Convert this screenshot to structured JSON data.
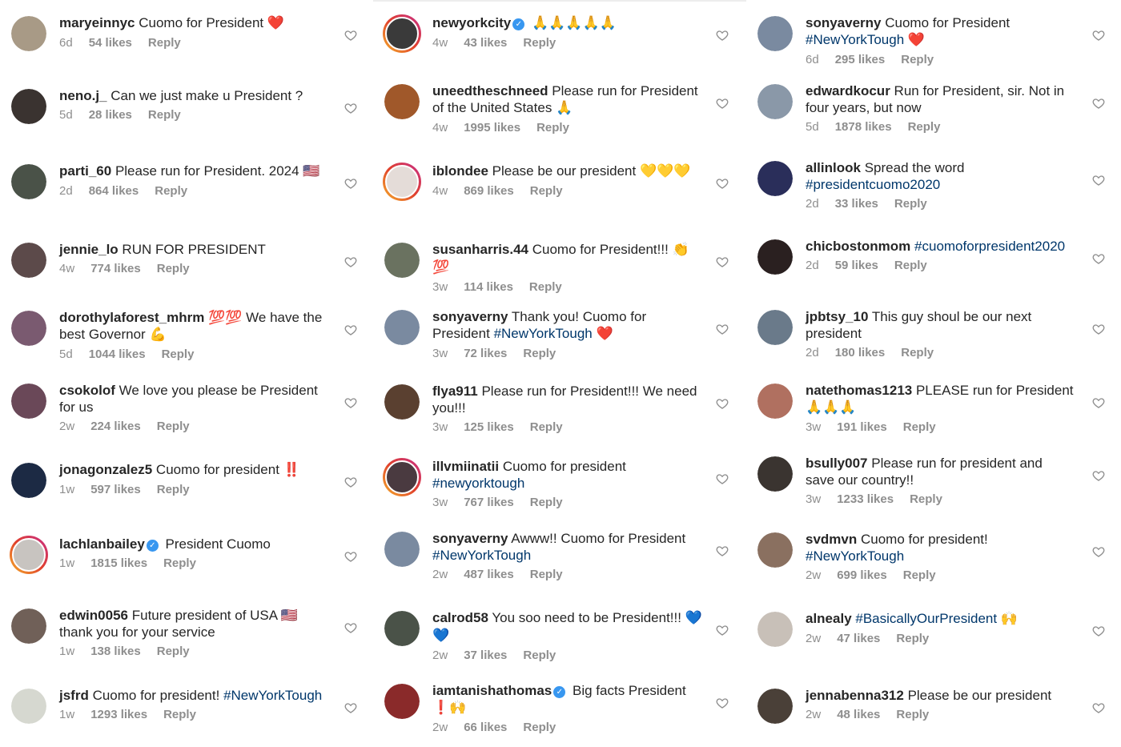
{
  "columns": [
    [
      {
        "user": "maryeinnyc",
        "verified": false,
        "text": "Cuomo for President",
        "tag": "",
        "emoji": "❤️",
        "emoji_color": "#e0202c",
        "time": "6d",
        "likes": "54 likes",
        "reply": "Reply",
        "avatar_color": "#a89a86",
        "ring": false
      },
      {
        "user": "neno.j_",
        "verified": false,
        "text": "Can we just make u President ?",
        "tag": "",
        "emoji": "",
        "time": "5d",
        "likes": "28 likes",
        "reply": "Reply",
        "avatar_color": "#3a3330",
        "ring": false
      },
      {
        "user": "parti_60",
        "verified": false,
        "text": "Please run for President. 2024",
        "tag": "",
        "emoji": "🇺🇸",
        "emoji_color": "#b22234",
        "time": "2d",
        "likes": "864 likes",
        "reply": "Reply",
        "avatar_color": "#4a5248",
        "ring": false
      },
      {
        "user": "jennie_lo",
        "verified": false,
        "text": "RUN FOR PRESIDENT",
        "tag": "",
        "emoji": "",
        "time": "4w",
        "likes": "774 likes",
        "reply": "Reply",
        "avatar_color": "#5c4a4a",
        "ring": false
      },
      {
        "user": "dorothylaforest_mhrm",
        "verified": false,
        "text": "💯💯 We have the best Governor",
        "tag": "",
        "emoji": "💪",
        "emoji_color": "#a0703c",
        "time": "5d",
        "likes": "1044 likes",
        "reply": "Reply",
        "avatar_color": "#7a5a70",
        "ring": false
      },
      {
        "user": "csokolof",
        "verified": false,
        "text": "We love you please be President for us",
        "tag": "",
        "emoji": "",
        "time": "2w",
        "likes": "224 likes",
        "reply": "Reply",
        "avatar_color": "#6a4858",
        "ring": false
      },
      {
        "user": "jonagonzalez5",
        "verified": false,
        "text": "Cuomo for president",
        "tag": "",
        "emoji": "‼️",
        "emoji_color": "#e0202c",
        "time": "1w",
        "likes": "597 likes",
        "reply": "Reply",
        "avatar_color": "#1c2a44",
        "ring": false
      },
      {
        "user": "lachlanbailey",
        "verified": true,
        "text": "President Cuomo",
        "tag": "",
        "emoji": "",
        "time": "1w",
        "likes": "1815 likes",
        "reply": "Reply",
        "avatar_color": "#c8c4c0",
        "ring": true
      },
      {
        "user": "edwin0056",
        "verified": false,
        "text": "Future president of USA 🇺🇸 thank you for your service",
        "tag": "",
        "emoji": "",
        "time": "1w",
        "likes": "138 likes",
        "reply": "Reply",
        "avatar_color": "#706058",
        "ring": false
      },
      {
        "user": "jsfrd",
        "verified": false,
        "text": "Cuomo for president!",
        "tag": "#NewYorkTough",
        "emoji": "",
        "time": "1w",
        "likes": "1293 likes",
        "reply": "Reply",
        "avatar_color": "#d6d8d0",
        "ring": false
      }
    ],
    [
      {
        "user": "newyorkcity",
        "verified": true,
        "text": "",
        "tag": "",
        "emoji": "🙏🙏🙏🙏🙏",
        "emoji_color": "#e0b070",
        "time": "4w",
        "likes": "43 likes",
        "reply": "Reply",
        "avatar_color": "#3a3a3a",
        "ring": true
      },
      {
        "user": "uneedtheschneed",
        "verified": false,
        "text": "Please run for President of the United States",
        "tag": "",
        "emoji": "🙏",
        "emoji_color": "#e0b070",
        "time": "4w",
        "likes": "1995 likes",
        "reply": "Reply",
        "avatar_color": "#a0582a",
        "ring": false
      },
      {
        "user": "iblondee",
        "verified": false,
        "text": "Please be our president",
        "tag": "",
        "emoji": "💛💛💛",
        "emoji_color": "#f2c20a",
        "time": "4w",
        "likes": "869 likes",
        "reply": "Reply",
        "avatar_color": "#e4dcd8",
        "ring": true
      },
      {
        "user": "susanharris.44",
        "verified": false,
        "text": "Cuomo for President!!!",
        "tag": "",
        "emoji": "👏💯",
        "emoji_color": "#e0a020",
        "time": "3w",
        "likes": "114 likes",
        "reply": "Reply",
        "avatar_color": "#6a7260",
        "ring": false
      },
      {
        "user": "sonyaverny",
        "verified": false,
        "text": "Thank you! Cuomo for President",
        "tag": "#NewYorkTough",
        "emoji": "❤️",
        "emoji_color": "#e0202c",
        "time": "3w",
        "likes": "72 likes",
        "reply": "Reply",
        "avatar_color": "#7a8aa0",
        "ring": false
      },
      {
        "user": "flya911",
        "verified": false,
        "text": "Please run for President!!! We need you!!!",
        "tag": "",
        "emoji": "",
        "time": "3w",
        "likes": "125 likes",
        "reply": "Reply",
        "avatar_color": "#5a4030",
        "ring": false
      },
      {
        "user": "illvmiinatii",
        "verified": false,
        "text": "Cuomo for president",
        "tag": "#newyorktough",
        "emoji": "",
        "time": "3w",
        "likes": "767 likes",
        "reply": "Reply",
        "avatar_color": "#4a3a40",
        "ring": true
      },
      {
        "user": "sonyaverny",
        "verified": false,
        "text": "Awww!! Cuomo for President",
        "tag": "#NewYorkTough",
        "emoji": "",
        "time": "2w",
        "likes": "487 likes",
        "reply": "Reply",
        "avatar_color": "#7a8aa0",
        "ring": false
      },
      {
        "user": "calrod58",
        "verified": false,
        "text": "You soo need to be President!!!",
        "tag": "",
        "emoji": "💙💙",
        "emoji_color": "#2a7ae0",
        "time": "2w",
        "likes": "37 likes",
        "reply": "Reply",
        "avatar_color": "#4a5248",
        "ring": false
      },
      {
        "user": "iamtanishathomas",
        "verified": true,
        "text": "Big facts President",
        "tag": "",
        "emoji": "❗🙌",
        "emoji_color": "#e0202c",
        "time": "2w",
        "likes": "66 likes",
        "reply": "Reply",
        "avatar_color": "#8a2a2a",
        "ring": false
      }
    ],
    [
      {
        "user": "sonyaverny",
        "verified": false,
        "text": "Cuomo for President",
        "tag": "#NewYorkTough",
        "emoji": "❤️",
        "emoji_color": "#e0202c",
        "time": "6d",
        "likes": "295 likes",
        "reply": "Reply",
        "avatar_color": "#7a8aa0",
        "ring": false
      },
      {
        "user": "edwardkocur",
        "verified": false,
        "text": "Run for President, sir. Not in four years, but now",
        "tag": "",
        "emoji": "",
        "time": "5d",
        "likes": "1878 likes",
        "reply": "Reply",
        "avatar_color": "#8a98a8",
        "ring": false
      },
      {
        "user": "allinlook",
        "verified": false,
        "text": "Spread the word",
        "tag": "#presidentcuomo2020",
        "emoji": "",
        "time": "2d",
        "likes": "33 likes",
        "reply": "Reply",
        "avatar_color": "#2a2e5a",
        "ring": false
      },
      {
        "user": "chicbostonmom",
        "verified": false,
        "text": "",
        "tag": "#cuomoforpresident2020",
        "emoji": "",
        "time": "2d",
        "likes": "59 likes",
        "reply": "Reply",
        "avatar_color": "#2a2020",
        "ring": false
      },
      {
        "user": "jpbtsy_10",
        "verified": false,
        "text": "This guy shoul be our next president",
        "tag": "",
        "emoji": "",
        "time": "2d",
        "likes": "180 likes",
        "reply": "Reply",
        "avatar_color": "#6a7a8a",
        "ring": false
      },
      {
        "user": "natethomas1213",
        "verified": false,
        "text": "PLEASE run for President",
        "tag": "",
        "emoji": "🙏🙏🙏",
        "emoji_color": "#a0703c",
        "time": "3w",
        "likes": "191 likes",
        "reply": "Reply",
        "avatar_color": "#b07060",
        "ring": false
      },
      {
        "user": "bsully007",
        "verified": false,
        "text": "Please run for president and save our country!!",
        "tag": "",
        "emoji": "",
        "time": "3w",
        "likes": "1233 likes",
        "reply": "Reply",
        "avatar_color": "#3a3430",
        "ring": false
      },
      {
        "user": "svdmvn",
        "verified": false,
        "text": "Cuomo for president!",
        "tag": "#NewYorkTough",
        "emoji": "",
        "time": "2w",
        "likes": "699 likes",
        "reply": "Reply",
        "avatar_color": "#8a7060",
        "ring": false
      },
      {
        "user": "alnealy",
        "verified": false,
        "text": "",
        "tag": "#BasicallyOurPresident",
        "emoji": "🙌",
        "emoji_color": "#d0a060",
        "time": "2w",
        "likes": "47 likes",
        "reply": "Reply",
        "avatar_color": "#c8c0b8",
        "ring": false
      },
      {
        "user": "jennabenna312",
        "verified": false,
        "text": "Please be our president",
        "tag": "",
        "emoji": "",
        "time": "2w",
        "likes": "48 likes",
        "reply": "Reply",
        "avatar_color": "#4a4038",
        "ring": false
      }
    ]
  ],
  "colors": {
    "username": "#262626",
    "meta": "#8e8e8e",
    "hashtag": "#00376b",
    "verified": "#3897f0",
    "ring_start": "#f5b02a",
    "ring_end": "#c72f8a"
  },
  "icons": {
    "like": "heart-outline-icon",
    "verified": "verified-badge-icon"
  }
}
